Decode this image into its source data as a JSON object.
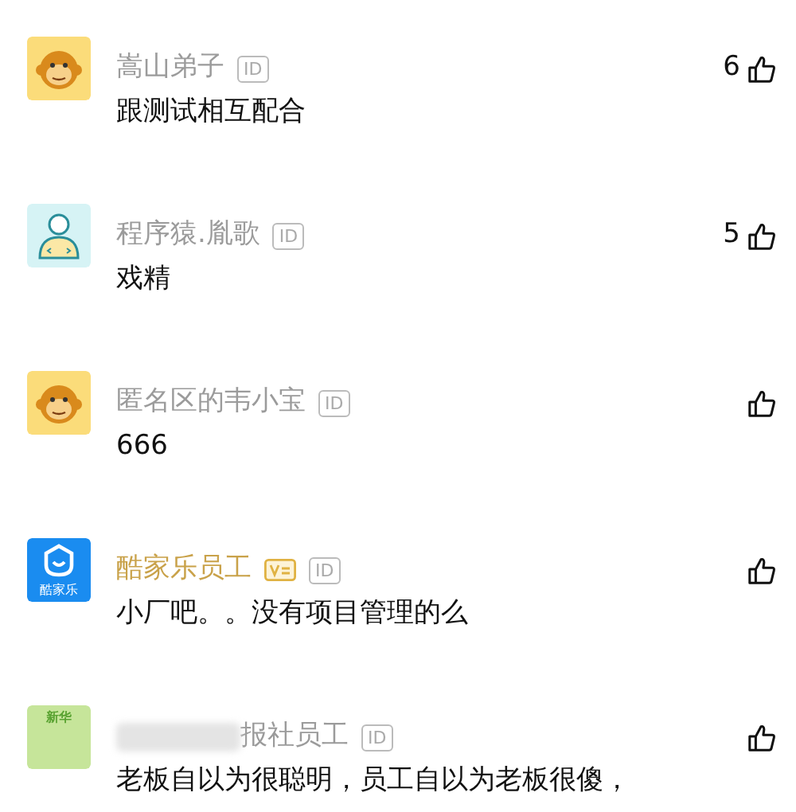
{
  "comments": [
    {
      "kind": "monkey",
      "name": "嵩山弟子",
      "color": "#9b9b9b",
      "verified": false,
      "name_masked": false,
      "badge": "ID",
      "text": "跟测试相互配合",
      "likes": "6"
    },
    {
      "kind": "coder",
      "name": "程序猿.胤歌",
      "color": "#9b9b9b",
      "verified": false,
      "name_masked": false,
      "badge": "ID",
      "text": "戏精",
      "likes": "5"
    },
    {
      "kind": "monkey",
      "name": "匿名区的韦小宝",
      "color": "#9b9b9b",
      "verified": false,
      "name_masked": false,
      "badge": "ID",
      "text": "666"
    },
    {
      "kind": "brand",
      "avatar_text": "酷家乐",
      "name": "酷家乐员工",
      "color": "#c9a24a",
      "verified": true,
      "name_masked": false,
      "badge": "ID",
      "text": "小厂吧。。没有项目管理的么"
    },
    {
      "kind": "green",
      "avatar_text": "新华",
      "name": "报社员工",
      "color": "#9b9b9b",
      "verified": false,
      "name_masked": true,
      "badge": "ID",
      "text": "老板自以为很聪明，员工自以为老板很傻，"
    }
  ]
}
